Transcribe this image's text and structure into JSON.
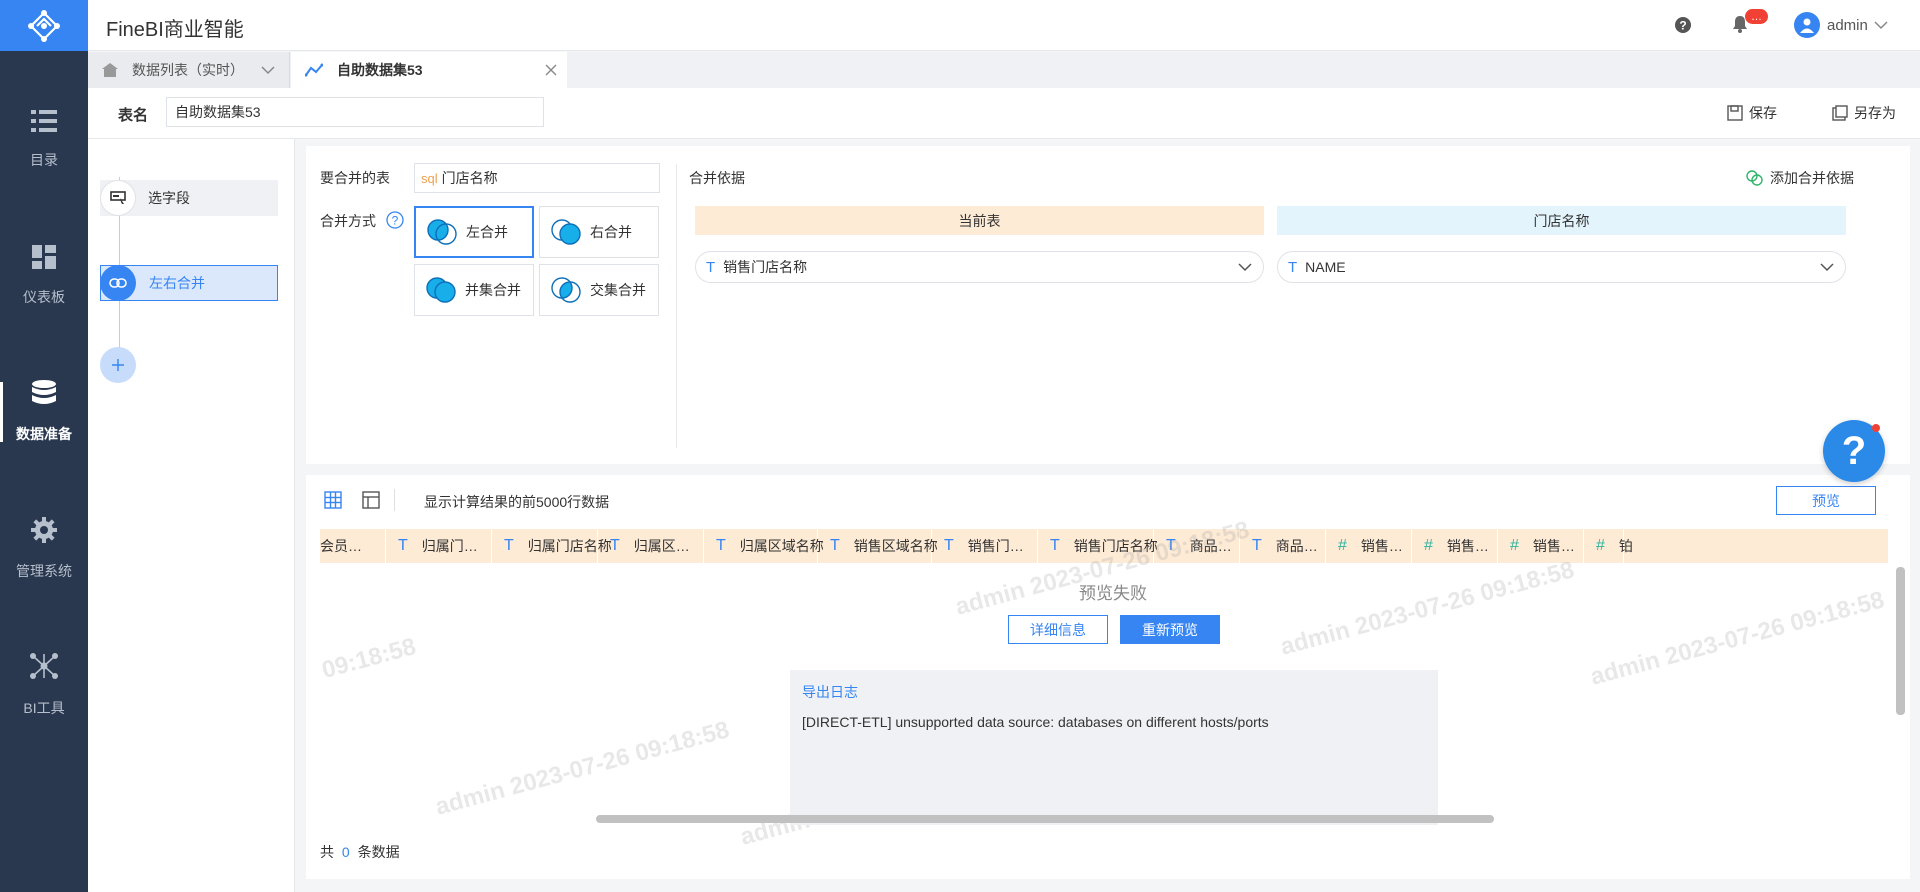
{
  "app": {
    "title": "FineBI商业智能"
  },
  "header": {
    "notification_badge": "…",
    "user": "admin"
  },
  "nav": {
    "items": [
      {
        "label": "目录",
        "icon": "list-icon"
      },
      {
        "label": "仪表板",
        "icon": "dashboard-icon"
      },
      {
        "label": "数据准备",
        "icon": "database-icon",
        "active": true
      },
      {
        "label": "管理系统",
        "icon": "gear-icon"
      },
      {
        "label": "BI工具",
        "icon": "network-icon"
      }
    ]
  },
  "tabs": [
    {
      "label": "数据列表（实时）"
    },
    {
      "label": "自助数据集53"
    }
  ],
  "namebar": {
    "label": "表名",
    "value": "自助数据集53",
    "save": "保存",
    "save_as": "另存为"
  },
  "steps": [
    {
      "label": "选字段"
    },
    {
      "label": "左右合并"
    }
  ],
  "config": {
    "merge_table_label": "要合并的表",
    "merge_table_prefix": "sql",
    "merge_table_value": "门店名称",
    "mode_label": "合并方式",
    "modes": [
      "左合并",
      "右合并",
      "并集合并",
      "交集合并"
    ],
    "selected_mode": "左合并",
    "basis_label": "合并依据",
    "add_basis": "添加合并依据",
    "current_table": "当前表",
    "other_table": "门店名称",
    "current_field": "销售门店名称",
    "other_field": "NAME"
  },
  "preview": {
    "info": "显示计算结果的前5000行数据",
    "preview_button": "预览",
    "columns": [
      {
        "name": "会员…",
        "type": ""
      },
      {
        "name": "归属门…",
        "type": "T"
      },
      {
        "name": "归属门店名称",
        "type": "T"
      },
      {
        "name": "归属区…",
        "type": "T"
      },
      {
        "name": "归属区域名称",
        "type": "T"
      },
      {
        "name": "销售区域名称",
        "type": "T"
      },
      {
        "name": "销售门…",
        "type": "T"
      },
      {
        "name": "销售门店名称",
        "type": "T"
      },
      {
        "name": "商品…",
        "type": "T"
      },
      {
        "name": "商品…",
        "type": "T"
      },
      {
        "name": "销售…",
        "type": "#"
      },
      {
        "name": "销售…",
        "type": "#"
      },
      {
        "name": "销售…",
        "type": "#"
      },
      {
        "name": "铂",
        "type": "#"
      }
    ],
    "fail_text": "预览失败",
    "detail_button": "详细信息",
    "retry_button": "重新预览",
    "log_title": "导出日志",
    "log_message": "[DIRECT-ETL] unsupported data source: databases on different hosts/ports",
    "footer_prefix": "共",
    "footer_count": "0",
    "footer_suffix": "条数据",
    "watermark": "admin 2023-07-26 09:18:58",
    "watermark_partial_time": "09:18:58"
  },
  "colors": {
    "sidebar": "#29384f",
    "brand": "#3685f2",
    "current_table_bg": "#fdebd6",
    "other_table_bg": "#e3f4fd"
  }
}
